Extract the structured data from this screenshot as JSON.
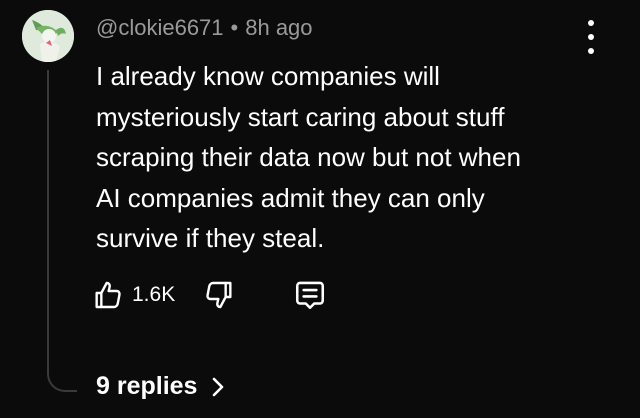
{
  "comment": {
    "username": "@clokie6671",
    "separator": "•",
    "timestamp": "8h ago",
    "text": "I already know companies will\nmysteriously start caring about stuff\nscraping their data now but not when\nAI companies admit they can only\nsurvive if they steal.",
    "like_count": "1.6K",
    "replies_label": "9 replies"
  },
  "icons": {
    "more": "more-vertical-icon",
    "like": "thumbs-up-icon",
    "dislike": "thumbs-down-icon",
    "reply": "comment-icon",
    "expand": "chevron-right-icon"
  },
  "colors": {
    "background": "#0b0b0b",
    "text": "#ffffff",
    "meta_text": "#9a9a9a",
    "thread_line": "#3a3a3a",
    "avatar_bg": "#dfe9dc"
  }
}
